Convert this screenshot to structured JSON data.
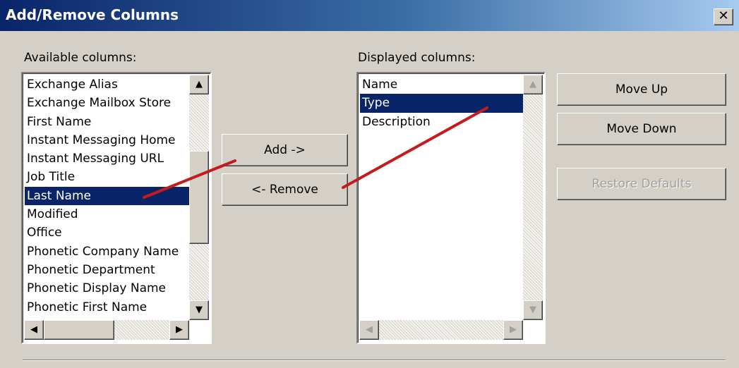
{
  "window": {
    "title": "Add/Remove Columns",
    "close_label": "✕"
  },
  "available": {
    "label": "Available columns:",
    "items": [
      "Exchange Alias",
      "Exchange Mailbox Store",
      "First Name",
      "Instant Messaging Home",
      "Instant Messaging URL",
      "Job Title",
      "Last Name",
      "Modified",
      "Office",
      "Phonetic Company Name",
      "Phonetic Department",
      "Phonetic Display Name",
      "Phonetic First Name"
    ],
    "selected_index": 6
  },
  "displayed": {
    "label": "Displayed columns:",
    "items": [
      "Name",
      "Type",
      "Description"
    ],
    "selected_index": 1
  },
  "buttons": {
    "add": "Add ->",
    "remove": "<- Remove",
    "move_up": "Move Up",
    "move_down": "Move Down",
    "restore": "Restore Defaults"
  },
  "scroll_glyphs": {
    "up": "▲",
    "down": "▼",
    "left": "◀",
    "right": "▶"
  },
  "colors": {
    "selection": "#0a246a",
    "annotation_arrow": "#c41c1c",
    "dialog_bg": "#d4d0c8"
  }
}
